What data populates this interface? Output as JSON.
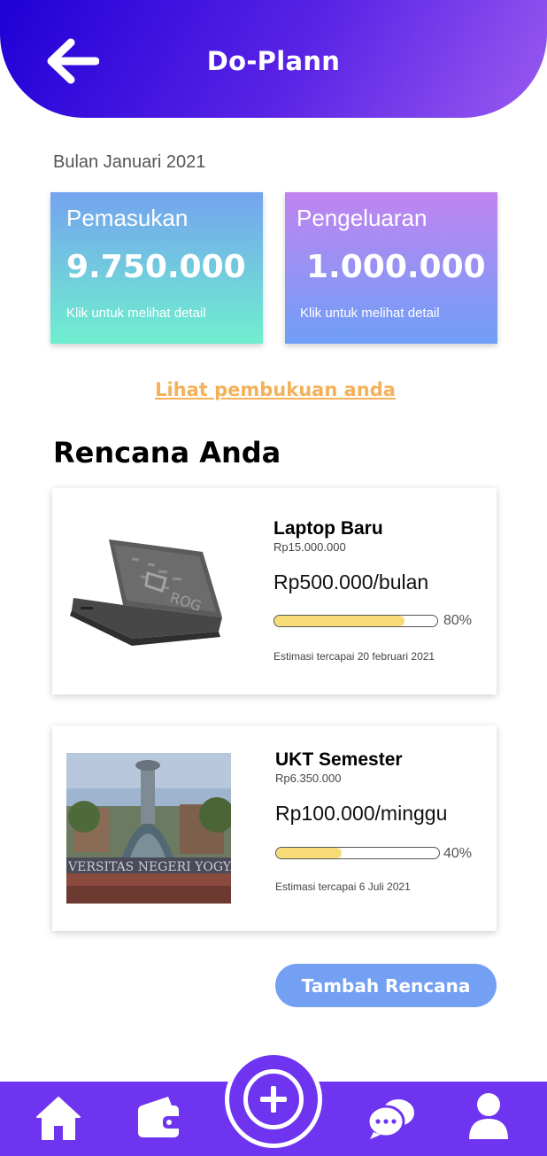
{
  "header": {
    "title": "Do-Plann"
  },
  "period": {
    "label": "Bulan Januari 2021"
  },
  "summary": {
    "income": {
      "title": "Pemasukan",
      "amount": "9.750.000",
      "hint": "Klik untuk melihat detail"
    },
    "expense": {
      "title": "Pengeluaran",
      "amount": "1.000.000",
      "hint": "Klik untuk melihat detail"
    }
  },
  "books_link": "Lihat pembukuan anda",
  "plans_title": "Rencana Anda",
  "plans": [
    {
      "name": "Laptop Baru",
      "total": "Rp15.000.000",
      "rate": "Rp500.000/bulan",
      "progress": 0.8,
      "progress_label": "80%",
      "estimate": "Estimasi tercapai 20 februari 2021",
      "image": "laptop-image"
    },
    {
      "name": "UKT Semester",
      "total": "Rp6.350.000",
      "rate": "Rp100.000/minggu",
      "progress": 0.4,
      "progress_label": "40%",
      "estimate": "Estimasi tercapai 6 Juli 2021",
      "image": "university-image"
    }
  ],
  "add_button": "Tambah Rencana",
  "nav": {
    "items": [
      "home-icon",
      "wallet-icon",
      "add-icon",
      "chat-icon",
      "profile-icon"
    ]
  },
  "colors": {
    "accent": "#6e34f0",
    "progress": "#f8dc78",
    "link": "#f4b15a",
    "button": "#74a0f3"
  }
}
